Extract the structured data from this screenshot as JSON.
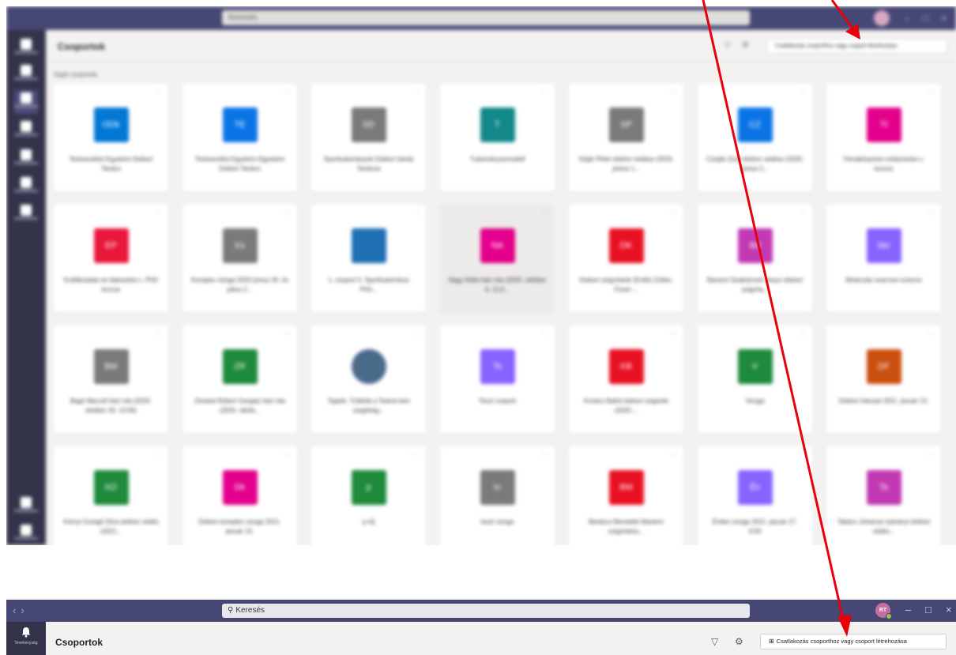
{
  "top": {
    "search_placeholder": "Keresés",
    "title": "Csoportok",
    "join_label": "Csatlakozás csoporthoz vagy csoport létrehozása",
    "section_label": "Saját csoportok",
    "more_glyph": "···",
    "cards": [
      {
        "initials": "ODk",
        "name": "Testnevelési Egyetem Doktori Tanács",
        "color": "#0078d4"
      },
      {
        "initials": "TE",
        "name": "Testnevelési Egyetem Egyetemi Doktori Tanács",
        "color": "#0a74e6"
      },
      {
        "initials": "SD",
        "name": "Sporttudományok Doktori Iskola Tanácsa",
        "color": "#7a7a7a"
      },
      {
        "initials": "T",
        "name": "Tudományosmodell",
        "color": "#13888a"
      },
      {
        "initials": "SP",
        "name": "Szijár Péter doktori védése (2020. június 1...",
        "color": "#7a7a7a"
      },
      {
        "initials": "CZ",
        "name": "Czirják Zsolt doktori védése (2020. június 2...",
        "color": "#0a74e6"
      },
      {
        "initials": "Tt",
        "name": "Témakörpontú módszertan c. kurzus",
        "color": "#e3008c"
      },
      {
        "initials": "EP",
        "name": "Erdélkutatás és fejlesztési c. PhD kurzus",
        "color": "#e8173b"
      },
      {
        "initials": "Ks",
        "name": "Komplex vizsga 2020 június 30. és július 2...",
        "color": "#7a7a7a"
      },
      {
        "initials": "",
        "name": "1. csoport II. Sporttudományi PhD...",
        "color": "#1f6fb4"
      },
      {
        "initials": "NA",
        "name": "Nagy Attila házi vita (2020. október 6. 11:0...",
        "color": "#e3008c"
      },
      {
        "initials": "DK",
        "name": "Doktori szigorlatok (Erdős Zoltán, Füzer-...",
        "color": "#e81123"
      },
      {
        "initials": "Bd",
        "name": "Baranni Szabolcsok Vezyo doktori szigorla...",
        "color": "#c239b3"
      },
      {
        "initials": "Mo",
        "name": "Molecular exercise science",
        "color": "#8764ff"
      },
      {
        "initials": "BM",
        "name": "Bagó Marcell házi vita (2020. október 26. 13:00)",
        "color": "#7a7a7a"
      },
      {
        "initials": "ZR",
        "name": "Zöndrai Róbert Gergely házi vita (2020. októb...",
        "color": "#1e8a3c"
      },
      {
        "initials": "",
        "name": "Tippek, Trükkök a Teams-ben (segítség...",
        "color": "#4a6a8a"
      },
      {
        "initials": "Ts",
        "name": "Teszt csoport",
        "color": "#8764ff"
      },
      {
        "initials": "KB",
        "name": "Kovács Balint doktori szigorlat (2020....",
        "color": "#e81123"
      },
      {
        "initials": "V",
        "name": "Vizsga",
        "color": "#1e8a3c"
      },
      {
        "initials": "DF",
        "name": "Doktori fokozat 2021. január 13.",
        "color": "#ca5010"
      },
      {
        "initials": "KD",
        "name": "Környi Grzegh Dóra doktori védés (2021...",
        "color": "#1e8a3c"
      },
      {
        "initials": "Dk",
        "name": "Doktori komplex vizsga 2021. január 15.",
        "color": "#e3008c"
      },
      {
        "initials": "p",
        "name": "p.r0j",
        "color": "#1e8a3c"
      },
      {
        "initials": "tv",
        "name": "teszt vizsga",
        "color": "#7a7a7a"
      },
      {
        "initials": "BM",
        "name": "Bardoco Benedek Mariann szigorlatos...",
        "color": "#e81123"
      },
      {
        "initials": "Év",
        "name": "Évfam vizsga 2021. január 27. 9:00",
        "color": "#8764ff"
      },
      {
        "initials": "Ts",
        "name": "Takács Johanna nyitványi doktori védés...",
        "color": "#c239b3"
      }
    ]
  },
  "bottom": {
    "search_placeholder": "Keresés",
    "avatar_initials": "RT",
    "rail_label": "Tevékenység",
    "title": "Csoportok",
    "join_label": "Csatlakozás csoporthoz vagy csoport létrehozása",
    "nav_back": "‹",
    "nav_fwd": "›",
    "search_icon": "⚲",
    "filter_icon": "▽",
    "gear_icon": "⚙",
    "join_icon": "⊞",
    "minimize_icon": "–",
    "maximize_icon": "□",
    "close_icon": "×"
  },
  "colors": {
    "teams_purple": "#464775",
    "rail": "#33344a",
    "arrow": "#e8000b"
  }
}
